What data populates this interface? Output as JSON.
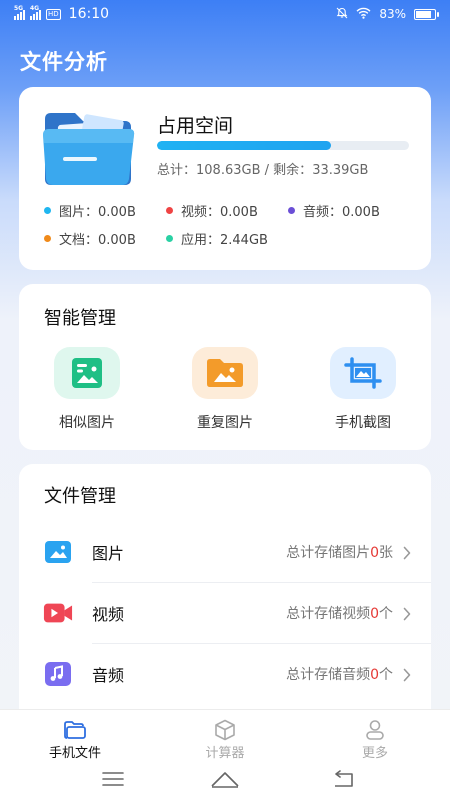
{
  "status_bar": {
    "network_1": "5G",
    "network_2": "4G",
    "hd": "HD",
    "time": "16:10",
    "battery_level": "83%",
    "battery_fraction": 0.83,
    "icons": [
      "mute-icon",
      "wifi-icon",
      "battery-icon"
    ]
  },
  "page": {
    "title": "文件分析"
  },
  "storage": {
    "title": "占用空间",
    "usage_fraction": 0.69,
    "total_label": "总计：",
    "total_value": "108.63GB",
    "separator": "/",
    "remaining_label": "剩余：",
    "remaining_value": "33.39GB",
    "legend": [
      {
        "label": "图片：0.00B",
        "color": "#1fb6f0"
      },
      {
        "label": "视频：0.00B",
        "color": "#ef4444"
      },
      {
        "label": "音频：0.00B",
        "color": "#6b4fd6"
      },
      {
        "label": "文档：0.00B",
        "color": "#f08a1a"
      },
      {
        "label": "应用：2.44GB",
        "color": "#2ad1a4"
      }
    ]
  },
  "smart": {
    "title": "智能管理",
    "tools": [
      {
        "label": "相似图片",
        "icon": "similar-image-icon",
        "bg": "#dff7ee",
        "color": "#1fbf85"
      },
      {
        "label": "重复图片",
        "icon": "duplicate-image-icon",
        "bg": "#fdecd9",
        "color": "#f39b2a"
      },
      {
        "label": "手机截图",
        "icon": "screenshot-icon",
        "bg": "#e1efff",
        "color": "#2e8ff0"
      }
    ]
  },
  "files": {
    "title": "文件管理",
    "rows": [
      {
        "label": "图片",
        "icon": "image-icon",
        "prefix": "总计存储图片",
        "count": "0",
        "unit": "张"
      },
      {
        "label": "视频",
        "icon": "video-icon",
        "prefix": "总计存储视频",
        "count": "0",
        "unit": "个"
      },
      {
        "label": "音频",
        "icon": "music-icon",
        "prefix": "总计存储音频",
        "count": "0",
        "unit": "个"
      }
    ]
  },
  "tabbar": {
    "tabs": [
      {
        "label": "手机文件",
        "icon": "phone-files-icon",
        "active": true
      },
      {
        "label": "计算器",
        "icon": "calculator-icon",
        "active": false
      },
      {
        "label": "更多",
        "icon": "more-person-icon",
        "active": false
      }
    ]
  },
  "accent": "#1fa3f0"
}
